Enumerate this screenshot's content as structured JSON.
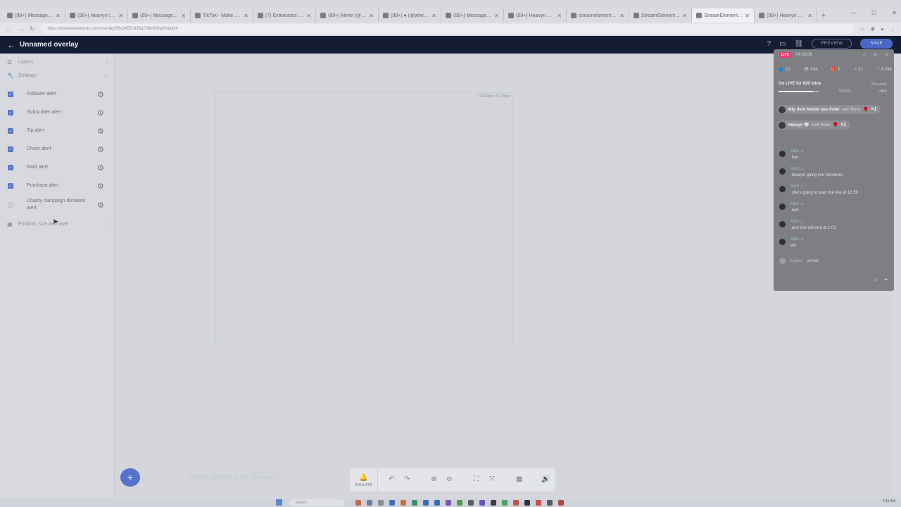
{
  "browser": {
    "tabs": [
      "(99+) Messages | TikTok",
      "(99+) Heavyn (@heav",
      "(99+) Messages | TikT",
      "TikTok - Make Your D",
      "(7) Extensions - Twitch",
      "(99+) Mime (@you mo",
      "(99+) ● (@whereisb",
      "(99+) Messages | TikT",
      "(99+) Heavyn 🤍 (@",
      "streamelements - Sea",
      "StreamElements - Ove",
      "StreamElements - ma",
      "(99+) Heavyn 🤍 (@"
    ],
    "active_tab_index": 11,
    "url": "https://streamelements.com/overlay/65c2455c835a738b920a59/editor"
  },
  "header": {
    "title": "Unnamed overlay",
    "preview_label": "PREVIEW",
    "save_label": "SAVE"
  },
  "sidebar": {
    "layers_label": "Layers",
    "settings_label": "Settings",
    "alerts": [
      {
        "label": "Follower alert",
        "checked": true
      },
      {
        "label": "Subscriber alert",
        "checked": true
      },
      {
        "label": "Tip alert",
        "checked": true
      },
      {
        "label": "Cheer alert",
        "checked": true
      },
      {
        "label": "Raid alert",
        "checked": true
      },
      {
        "label": "Purchase alert",
        "checked": true
      },
      {
        "label": "Charity campaign donation alert",
        "checked": false
      }
    ],
    "position_label": "Position, size and style"
  },
  "canvas": {
    "dimensions": "713.20px x 517.84px",
    "hint_text": "Move widget with",
    "hint_key": "arrows"
  },
  "toolbar": {
    "emulate_label": "EMULATE"
  },
  "live_panel": {
    "live_badge": "LIVE",
    "timer": "04:03:06",
    "stats": {
      "viewers": "13",
      "views": "834",
      "gifts": "2",
      "shares": "22",
      "likes": "6,094"
    },
    "goal_text": "Go LIVE for 920 mins",
    "this_week": "This week",
    "progress_text": "796/920",
    "progress_fraction": 0.865,
    "reward_text": "×560",
    "gifts": [
      {
        "name": "titty dick twister ass fister",
        "action": "sent Rose",
        "count": "×1"
      },
      {
        "name": "Heavyn 🤍",
        "action": "sent Rose",
        "count": "×1"
      }
    ],
    "chat": [
      {
        "user": "Azul",
        "message": ".live"
      },
      {
        "user": "Azul",
        "message": ".heavyn going live tomorrow"
      },
      {
        "user": "Azul",
        "message": ".she's going to start the live at 12:39"
      },
      {
        "user": "Azul",
        "message": ".nah"
      },
      {
        "user": "Azul",
        "message": ".and she will end at 1:03"
      },
      {
        "user": "Azul",
        "message": "am"
      }
    ],
    "joined_user": "Kaylee",
    "joined_action": "joined"
  },
  "taskbar": {
    "search_placeholder": "Search",
    "time": "4:11 AM"
  },
  "colors": {
    "header_bg": "#141d33",
    "accent": "#5873c6",
    "live": "#f23a6c"
  }
}
